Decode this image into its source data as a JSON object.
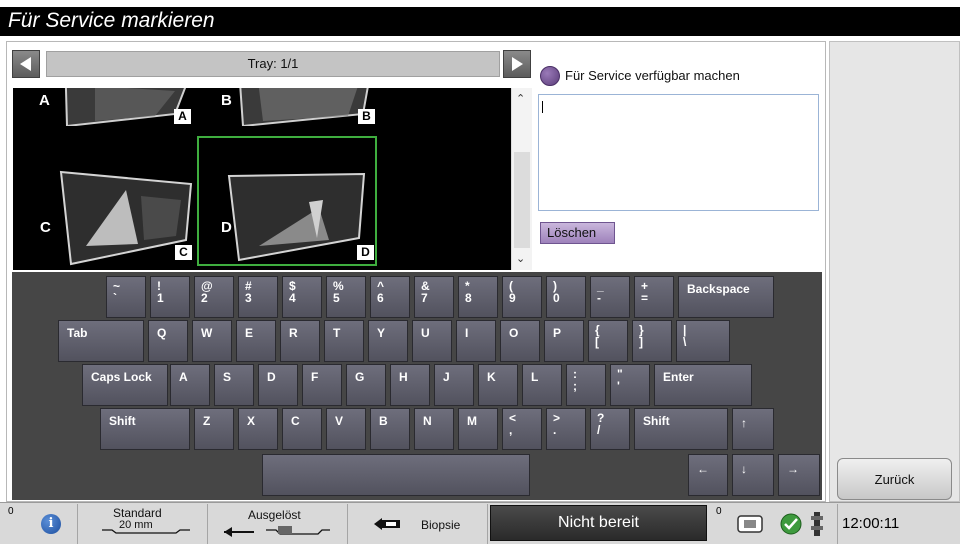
{
  "window": {
    "title": "Für Service markieren"
  },
  "tray": {
    "label": "Tray: 1/1"
  },
  "thumbnails": [
    {
      "letter": "A",
      "box": "A",
      "selected": false
    },
    {
      "letter": "B",
      "box": "B",
      "selected": false
    },
    {
      "letter": "C",
      "box": "C",
      "selected": false
    },
    {
      "letter": "D",
      "box": "D",
      "selected": true
    }
  ],
  "service": {
    "radio_label": "Für Service verfügbar machen",
    "text_value": "",
    "clear_label": "Löschen"
  },
  "keyboard": {
    "row1": [
      "~\n`",
      "!\n1",
      "@\n2",
      "#\n3",
      "$\n4",
      "%\n5",
      "^\n6",
      "&\n7",
      "*\n8",
      "(\n9",
      ")\n0",
      "_\n-",
      "+\n=",
      "Backspace"
    ],
    "row2": [
      "Tab",
      "Q",
      "W",
      "E",
      "R",
      "T",
      "Y",
      "U",
      "I",
      "O",
      "P",
      "{\n[",
      "}\n]",
      "|\n\\"
    ],
    "row3": [
      "Caps Lock",
      "A",
      "S",
      "D",
      "F",
      "G",
      "H",
      "J",
      "K",
      "L",
      ":\n;",
      "\"\n'",
      "Enter"
    ],
    "row4": [
      "Shift",
      "Z",
      "X",
      "C",
      "V",
      "B",
      "N",
      "M",
      "<\n,",
      ">\n.",
      "?\n/",
      "Shift",
      "↑"
    ],
    "row5": [
      "",
      "←",
      "↓",
      "→"
    ]
  },
  "back_label": "Zurück",
  "statusbar": {
    "count_left": "0",
    "standard_label": "Standard",
    "standard_value": "20 mm",
    "released_label": "Ausgelöst",
    "biopsy_label": "Biopsie",
    "state_label": "Nicht bereit",
    "count_right": "0",
    "time": "12:00:11"
  }
}
